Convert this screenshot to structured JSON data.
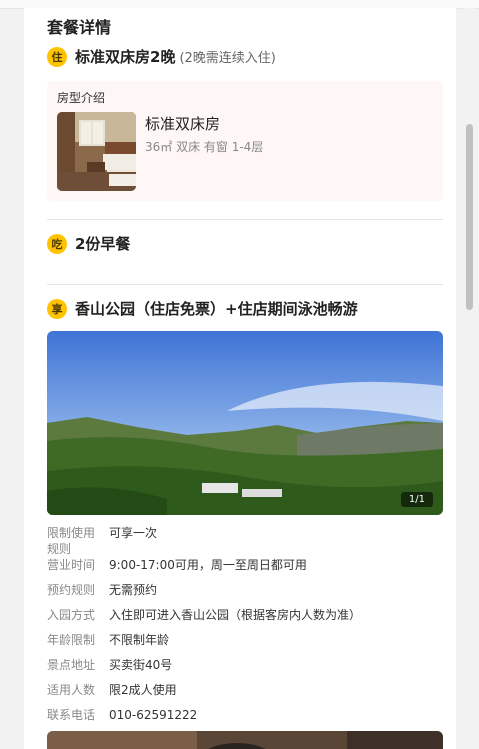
{
  "package": {
    "section_title": "套餐详情",
    "stay": {
      "badge": "住",
      "title": "标准双床房2晚",
      "note": "(2晚需连续入住)",
      "room_intro_label": "房型介绍",
      "room_name": "标准双床房",
      "room_meta": "36㎡  双床  有窗  1-4层"
    },
    "meal": {
      "badge": "吃",
      "title": "2份早餐"
    },
    "enjoy": {
      "badge": "享",
      "title": "香山公园（住店免票）+住店期间泳池畅游",
      "photo_counter": "1/1",
      "details": [
        {
          "label": "限制使用规则",
          "value": "可享一次"
        },
        {
          "label": "营业时间",
          "value": "9:00-17:00可用，周一至周日都可用"
        },
        {
          "label": "预约规则",
          "value": "无需预约"
        },
        {
          "label": "入园方式",
          "value": "入住即可进入香山公园（根据客房内人数为准）"
        },
        {
          "label": "年龄限制",
          "value": "不限制年龄"
        },
        {
          "label": "景点地址",
          "value": "买卖街40号"
        },
        {
          "label": "适用人数",
          "value": "限2成人使用"
        },
        {
          "label": "联系电话",
          "value": "010-62591222"
        }
      ]
    }
  },
  "colors": {
    "badge": "#ffc300",
    "room_box_bg": "#fef7f5"
  }
}
